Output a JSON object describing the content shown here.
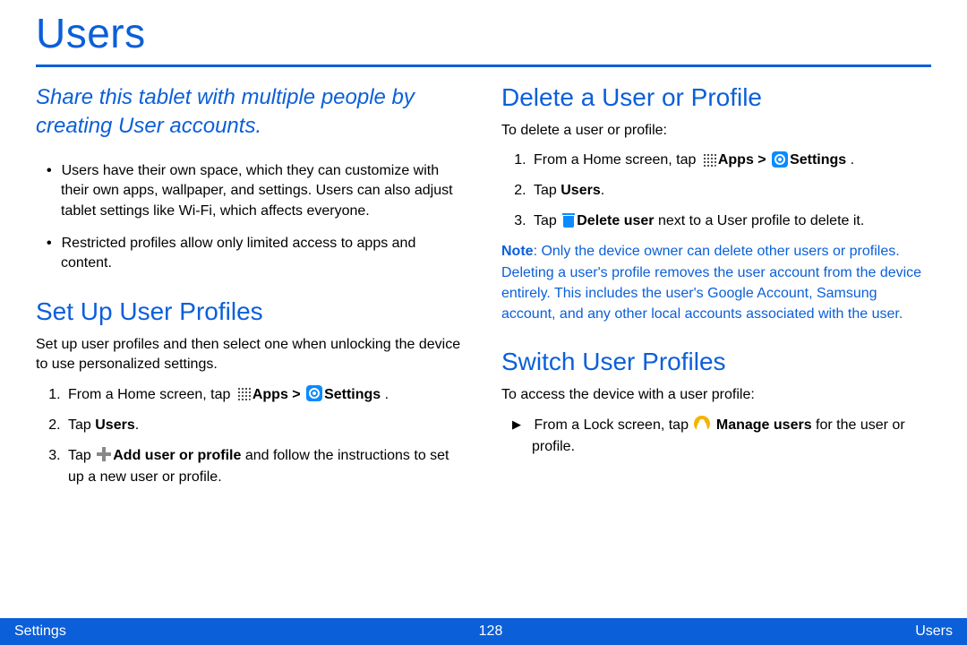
{
  "page": {
    "title": "Users",
    "intro": "Share this tablet with multiple people by creating User accounts.",
    "bullet1": "Users have their own space, which they can customize with their own apps, wallpaper, and settings. Users can also adjust tablet settings like Wi-Fi, which affects everyone.",
    "bullet2": "Restricted profiles allow only limited access to apps and content."
  },
  "setUp": {
    "heading": "Set Up User Profiles",
    "intro": "Set up user profiles and then select one when unlocking the device to use personalized settings.",
    "step1_prefix": "From a Home screen, tap ",
    "apps_label": "Apps > ",
    "settings_label": "Settings",
    "period": " .",
    "step2_prefix": "Tap ",
    "step2_bold": "Users",
    "step2_suffix": ".",
    "step3_prefix": "Tap ",
    "step3_bold": "Add user or profile",
    "step3_suffix": " and follow the instructions to set up a new user or profile."
  },
  "deleteSec": {
    "heading": "Delete a User or Profile",
    "intro": "To delete a user or profile:",
    "step1_prefix": "From a Home screen, tap ",
    "apps_label": "Apps > ",
    "settings_label": "Settings",
    "period": " .",
    "step2_prefix": "Tap ",
    "step2_bold": "Users",
    "step2_suffix": ".",
    "step3_prefix": "Tap ",
    "step3_bold": "Delete user",
    "step3_suffix": " next to a User profile to delete it.",
    "note_label": "Note",
    "note_body": ": Only the device owner can delete other users or profiles. Deleting a user's profile removes the user account from the device entirely. This includes the user's Google Account, Samsung account, and any other local accounts associated with the user."
  },
  "switchSec": {
    "heading": "Switch User Profiles",
    "intro": "To access the device with a user profile:",
    "step_prefix": "From a Lock screen, tap ",
    "step_bold": "Manage users",
    "step_suffix": " for the user or profile."
  },
  "footer": {
    "left": "Settings",
    "center": "128",
    "right": "Users"
  }
}
